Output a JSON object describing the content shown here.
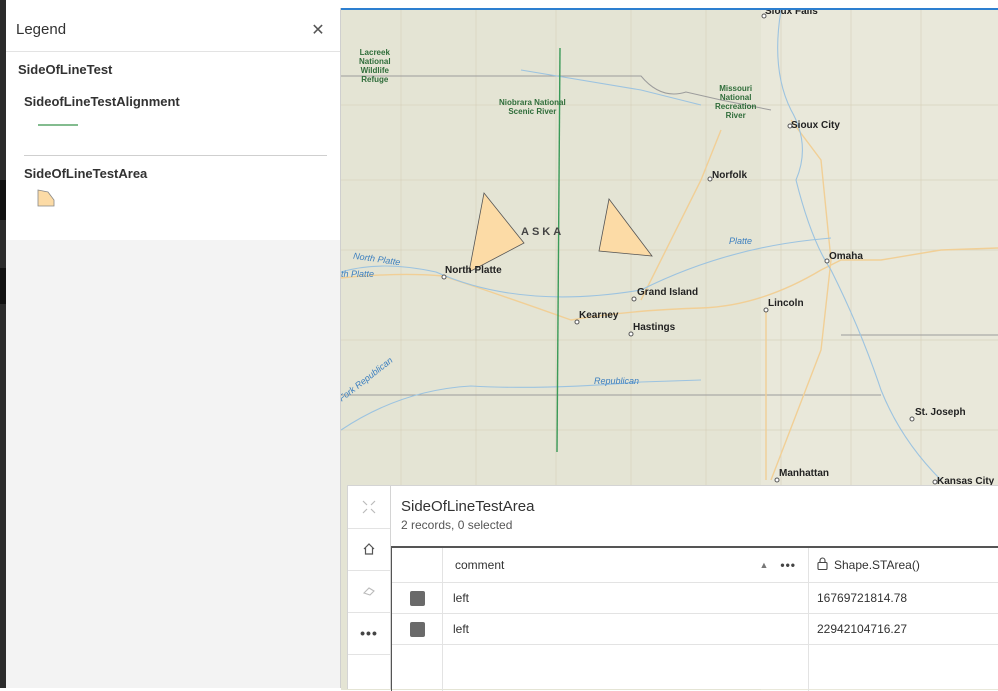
{
  "legend": {
    "title": "Legend",
    "close_icon": "close-icon",
    "layer": "SideOfLineTest",
    "sublayers": [
      {
        "label": "SideofLineTestAlignment",
        "symbol": "line",
        "color": "#5aa66a"
      },
      {
        "label": "SideOfLineTestArea",
        "symbol": "polygon",
        "color": "#fcdba6"
      }
    ]
  },
  "map": {
    "labels": [
      {
        "text": "Sioux Falls",
        "kind": "city"
      },
      {
        "text": "Sioux City",
        "kind": "city"
      },
      {
        "text": "Norfolk",
        "kind": "city"
      },
      {
        "text": "Omaha",
        "kind": "city"
      },
      {
        "text": "North Platte",
        "kind": "city"
      },
      {
        "text": "Grand Island",
        "kind": "city"
      },
      {
        "text": "Lincoln",
        "kind": "city"
      },
      {
        "text": "Kearney",
        "kind": "city"
      },
      {
        "text": "Hastings",
        "kind": "city"
      },
      {
        "text": "St. Joseph",
        "kind": "city"
      },
      {
        "text": "Manhattan",
        "kind": "city"
      },
      {
        "text": "Kansas City",
        "kind": "city"
      },
      {
        "text": "ASKA",
        "kind": "state"
      },
      {
        "text": "Lacreek\nNational\nWildlife\nRefuge",
        "kind": "park"
      },
      {
        "text": "Niobrara National\nScenic River",
        "kind": "park"
      },
      {
        "text": "Missouri\nNational\nRecreation\nRiver",
        "kind": "park"
      },
      {
        "text": "Platte",
        "kind": "water"
      },
      {
        "text": "North Platte",
        "kind": "water"
      },
      {
        "text": "th Platte",
        "kind": "water"
      },
      {
        "text": "Republican",
        "kind": "water"
      },
      {
        "text": "n Fork Republican",
        "kind": "water"
      }
    ],
    "colors": {
      "polygon_fill": "#fcdba6",
      "alignment_line": "#3a9a58",
      "highlight_border": "#2d7fd0"
    }
  },
  "table": {
    "title": "SideOfLineTestArea",
    "subtitle": "2 records, 0 selected",
    "tools": [
      "zoom-to-icon",
      "home-icon",
      "erase-icon",
      "more-icon"
    ],
    "columns": [
      "comment",
      "Shape.STArea()"
    ],
    "rows": [
      {
        "comment": "left",
        "area": "16769721814.78"
      },
      {
        "comment": "left",
        "area": "22942104716.27"
      }
    ],
    "more_label": "•••"
  }
}
